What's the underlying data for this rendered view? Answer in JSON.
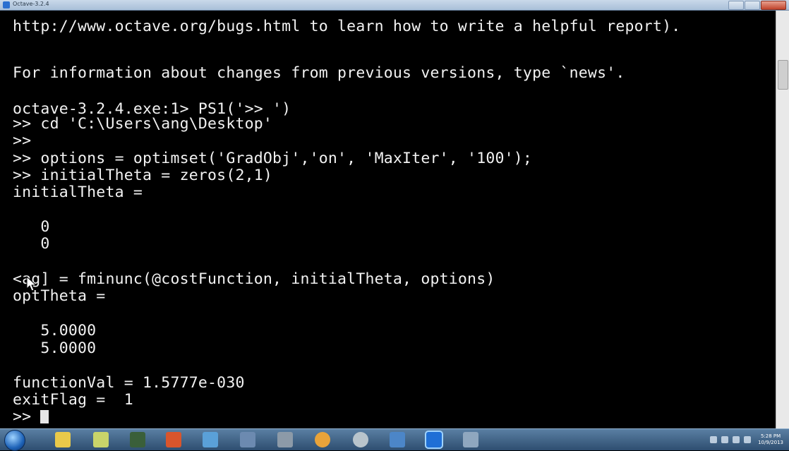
{
  "window": {
    "title": "Octave-3.2.4"
  },
  "console": {
    "lines": [
      "http://www.octave.org/bugs.html to learn how to write a helpful report).",
      "",
      "For information about changes from previous versions, type `news'.",
      "",
      "octave-3.2.4.exe:1> PS1('>> ')",
      ">> cd 'C:\\Users\\ang\\Desktop'",
      ">>",
      ">> options = optimset('GradObj','on', 'MaxIter', '100');",
      ">> initialTheta = zeros(2,1)",
      "initialTheta =",
      "",
      "   0",
      "   0",
      "",
      "<ag] = fminunc(@costFunction, initialTheta, options)",
      "optTheta =",
      "",
      "   5.0000",
      "   5.0000",
      "",
      "functionVal = 1.5777e-030",
      "exitFlag =  1",
      ">> "
    ]
  },
  "taskbar": {
    "clock_time": "5:28 PM",
    "clock_date": "10/9/2013",
    "icons": [
      "start-orb-icon",
      "explorer-icon",
      "folder-icon",
      "media-icon",
      "powerpoint-icon",
      "paint-icon",
      "network-icon",
      "calculator-icon",
      "chrome-icon",
      "app-icon",
      "shield-icon",
      "octave-icon",
      "window-icon"
    ]
  }
}
